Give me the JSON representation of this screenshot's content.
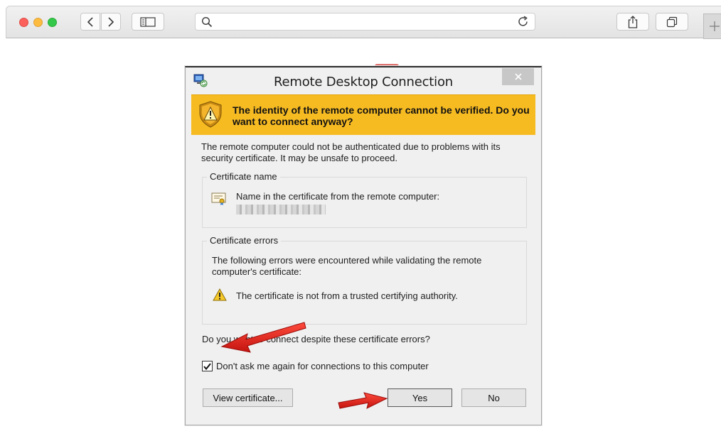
{
  "browser": {
    "address_placeholder": ""
  },
  "dialog": {
    "title": "Remote Desktop Connection",
    "warning_heading": "The identity of the remote computer cannot be verified. Do you want to connect anyway?",
    "description": "The remote computer could not be authenticated due to problems with its security certificate. It may be unsafe to proceed.",
    "certificate_group": {
      "legend": "Certificate name",
      "label": "Name in the certificate from the remote computer:"
    },
    "errors_group": {
      "legend": "Certificate errors",
      "description": "The following errors were encountered while validating the remote computer's certificate:",
      "error_item": "The certificate is not from a trusted certifying authority."
    },
    "question": "Do you want to connect despite these certificate errors?",
    "checkbox": {
      "label": "Don't ask me again for connections to this computer",
      "checked": true
    },
    "buttons": {
      "view_certificate": "View certificate...",
      "yes": "Yes",
      "no": "No"
    }
  },
  "colors": {
    "banner": "#f7bb22",
    "annotation_arrow": "#e0201b"
  }
}
